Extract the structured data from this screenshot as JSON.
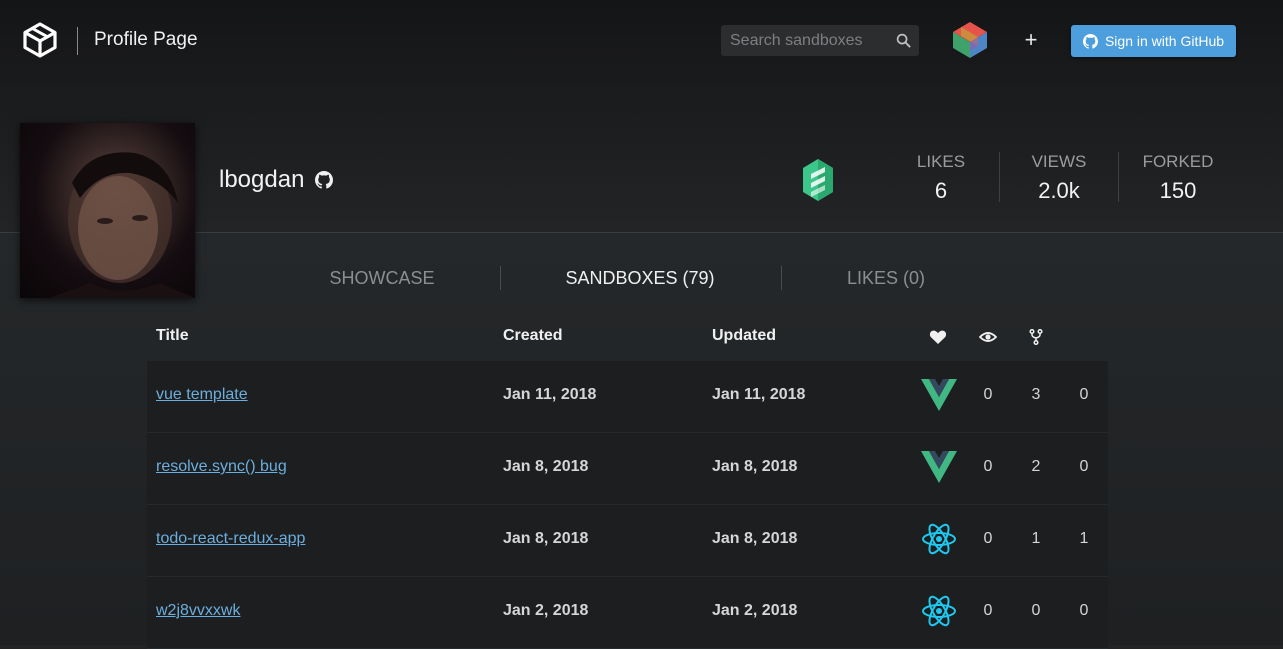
{
  "header": {
    "page_title": "Profile Page",
    "search_placeholder": "Search sandboxes",
    "new_sandbox_label": "+",
    "signin_label": "Sign in with GitHub"
  },
  "profile": {
    "username": "lbogdan",
    "stats": [
      {
        "label": "LIKES",
        "value": "6"
      },
      {
        "label": "VIEWS",
        "value": "2.0k"
      },
      {
        "label": "FORKED",
        "value": "150"
      }
    ]
  },
  "tabs": [
    {
      "label": "SHOWCASE",
      "active": false
    },
    {
      "label": "SANDBOXES (79)",
      "active": true
    },
    {
      "label": "LIKES (0)",
      "active": false
    }
  ],
  "table": {
    "columns": {
      "title": "Title",
      "created": "Created",
      "updated": "Updated"
    },
    "stat_icons": [
      "heart-icon",
      "eye-icon",
      "fork-icon"
    ],
    "rows": [
      {
        "title": "vue template",
        "created": "Jan 11, 2018",
        "updated": "Jan 11, 2018",
        "template": "vue",
        "likes": "0",
        "views": "3",
        "forks": "0"
      },
      {
        "title": "resolve.sync() bug",
        "created": "Jan 8, 2018",
        "updated": "Jan 8, 2018",
        "template": "vue",
        "likes": "0",
        "views": "2",
        "forks": "0"
      },
      {
        "title": "todo-react-redux-app",
        "created": "Jan 8, 2018",
        "updated": "Jan 8, 2018",
        "template": "react",
        "likes": "0",
        "views": "1",
        "forks": "1"
      },
      {
        "title": "w2j8vvxxwk",
        "created": "Jan 2, 2018",
        "updated": "Jan 2, 2018",
        "template": "react",
        "likes": "0",
        "views": "0",
        "forks": "0"
      }
    ]
  },
  "colors": {
    "accent": "#4c9fdc",
    "link": "#6caedd",
    "vue_green": "#41b883",
    "react_cyan": "#1ec8ee"
  }
}
